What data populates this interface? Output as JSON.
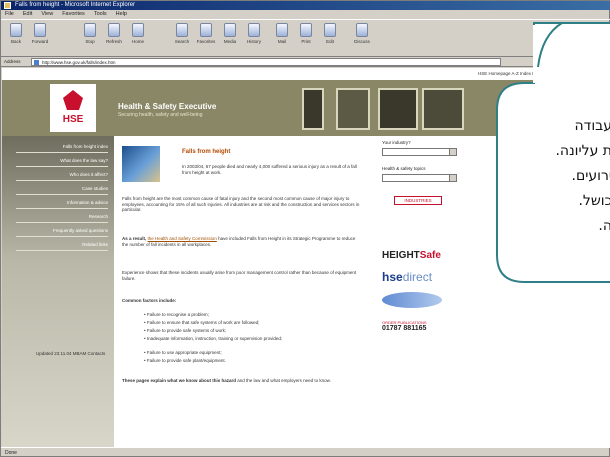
{
  "window": {
    "title": "Falls from height - Microsoft Internet Explorer"
  },
  "menu": [
    "File",
    "Edit",
    "View",
    "Favorites",
    "Tools",
    "Help"
  ],
  "toolbar": [
    "Back",
    "Forward",
    "Stop",
    "Refresh",
    "Home",
    "Search",
    "Favorites",
    "Media",
    "History",
    "Mail",
    "Print",
    "Edit",
    "Discuss"
  ],
  "address": {
    "label": "Address",
    "url": "http://www.hse.gov.uk/falls/index.htm"
  },
  "topnav": "HSE Homepage  A-Z Index  Feedback  Search  Contact us  Welsh",
  "banner": {
    "logo": "HSE",
    "title": "Health & Safety Executive",
    "subtitle": "Securing health, safety and well-being"
  },
  "sidebar": [
    "Falls from height index",
    "What does the law say?",
    "Who does it affect?",
    "Case studies",
    "Information & advice",
    "Research",
    "Frequently asked questions",
    "Related links"
  ],
  "updated": "Updated 23.11.04  MBAM Contacts",
  "content": {
    "title": "Falls from height",
    "intro": "In 2003/04, 67 people died and nearly 4,000 suffered a serious injury as a result of a fall from height at work.",
    "p1": "Falls from height are the most common cause of fatal injury and the second most common cause of major injury to employees, accounting for 15% of all such injuries. All industries are at risk and the construction and services sectors in particular.",
    "p2_lead": "As a result,",
    "p2_link": "the Health and Safety Commission",
    "p2_rest": "have included Falls from Height in its Strategic Programme to reduce the number of fall incidents in all workplaces.",
    "p3": "Experience shows that these incidents usually arise from poor management control rather than because of equipment failure.",
    "causes_title": "Common factors include:",
    "bullets": [
      "Failure to recognise a problem;",
      "Failure to ensure that safe systems of work are followed;",
      "Failure to provide safe systems of work;",
      "Inadequate information, instruction, training or supervision provided;",
      "Failure to use appropriate equipment;",
      "Failure to provide safe plant/equipment."
    ],
    "footer_bold": "These pages explain what we know about this hazard",
    "footer_rest": "and the law and what employers need to know."
  },
  "right": {
    "industry_label": "Your industry?",
    "topic_label": "Health & safety topics",
    "go": "INDUSTRIES",
    "heightsafe": "HEIGHT",
    "heightsafe2": "Safe",
    "hsedirect": "hse",
    "hsedirect2": "direct",
    "phone_label": "ORDER PUBLICATIONS",
    "phone": "01787 881165"
  },
  "status": "Done",
  "callout": {
    "lines": [
      "עבודה",
      "ת עליונה.",
      "ירועים.",
      "כושל.",
      "ה."
    ]
  }
}
